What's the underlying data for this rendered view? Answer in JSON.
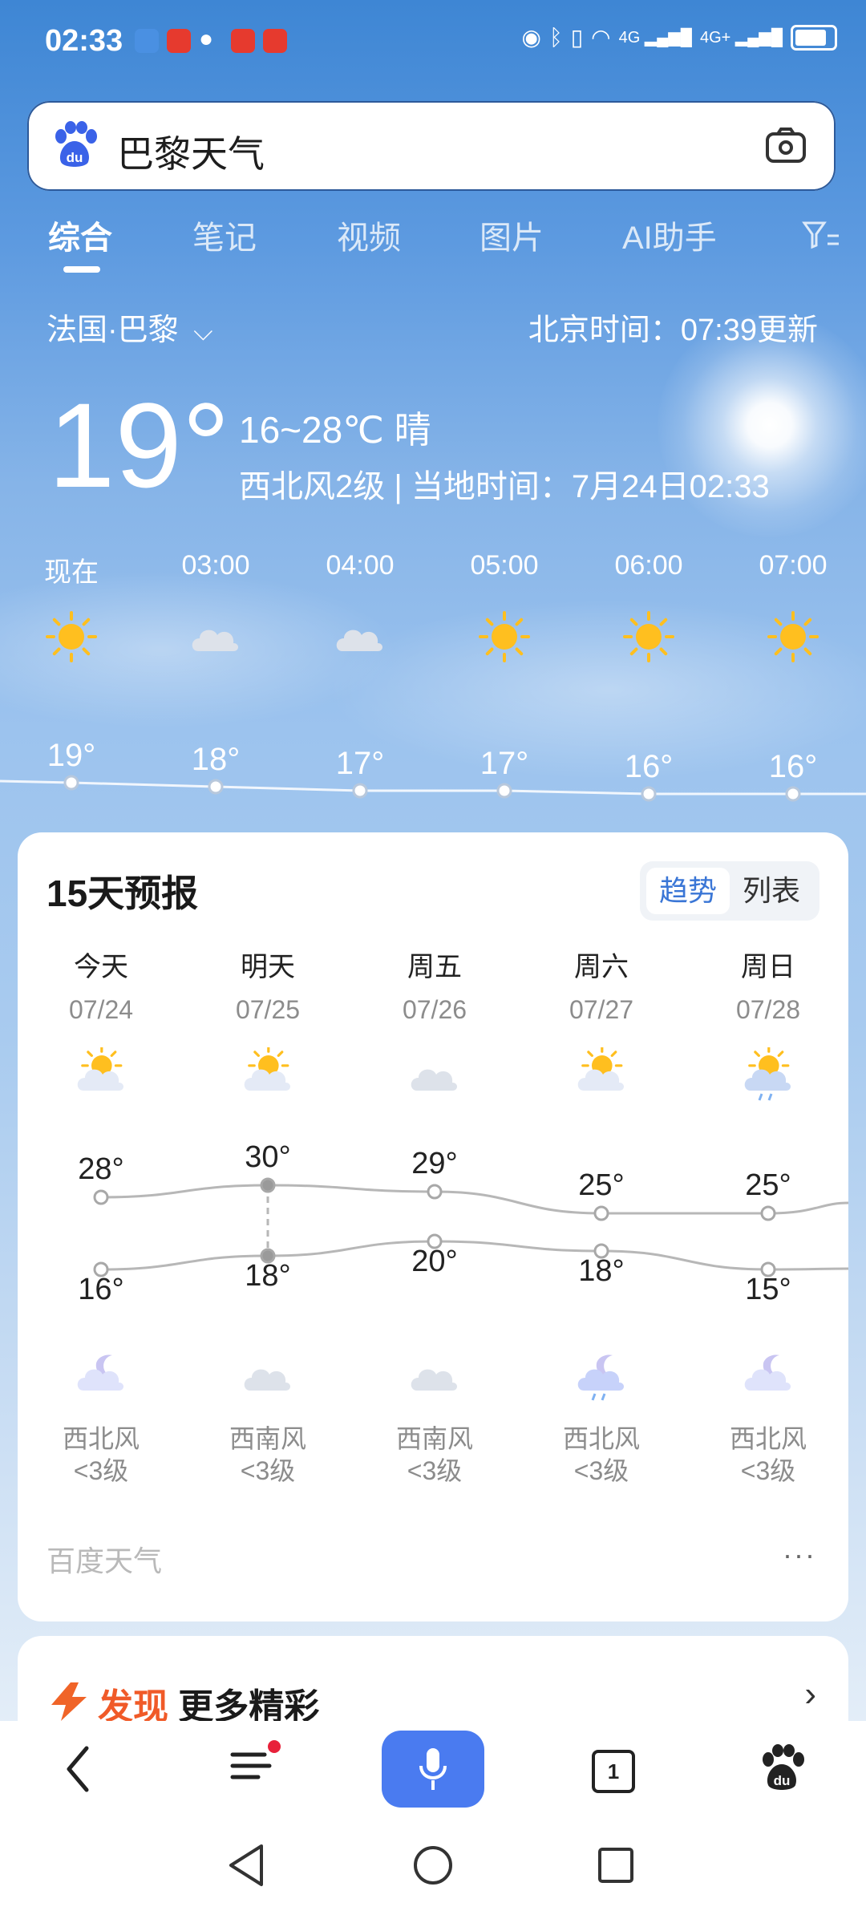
{
  "status": {
    "time": "02:33",
    "net1": "4G",
    "net2": "4G+"
  },
  "search": {
    "query": "巴黎天气"
  },
  "tabs": [
    "综合",
    "笔记",
    "视频",
    "图片",
    "AI助手"
  ],
  "weather": {
    "location": "法国·巴黎",
    "update": "北京时间：07:39更新",
    "current_temp": "19°",
    "range_condition": "16~28℃ 晴",
    "wind_local": "西北风2级 | 当地时间：7月24日02:33"
  },
  "hourly": [
    {
      "time": "现在",
      "icon": "sun-icon",
      "temp": "19°"
    },
    {
      "time": "03:00",
      "icon": "cloud-icon",
      "temp": "18°"
    },
    {
      "time": "04:00",
      "icon": "cloud-icon",
      "temp": "17°"
    },
    {
      "time": "05:00",
      "icon": "sun-icon",
      "temp": "17°"
    },
    {
      "time": "06:00",
      "icon": "sun-icon",
      "temp": "16°"
    },
    {
      "time": "07:00",
      "icon": "sun-icon",
      "temp": "16°"
    }
  ],
  "forecast": {
    "title": "15天预报",
    "toggle": [
      "趋势",
      "列表"
    ],
    "days": [
      {
        "name": "今天",
        "date": "07/24",
        "high": "28°",
        "low": "16°",
        "wind": "西北风",
        "level": "<3级",
        "day_icon": "partly-sunny-icon",
        "night_icon": "moon-cloud-icon"
      },
      {
        "name": "明天",
        "date": "07/25",
        "high": "30°",
        "low": "18°",
        "wind": "西南风",
        "level": "<3级",
        "day_icon": "partly-sunny-icon",
        "night_icon": "cloud-icon"
      },
      {
        "name": "周五",
        "date": "07/26",
        "high": "29°",
        "low": "20°",
        "wind": "西南风",
        "level": "<3级",
        "day_icon": "cloud-icon",
        "night_icon": "cloud-icon"
      },
      {
        "name": "周六",
        "date": "07/27",
        "high": "25°",
        "low": "18°",
        "wind": "西北风",
        "level": "<3级",
        "day_icon": "partly-sunny-icon",
        "night_icon": "moon-rain-icon"
      },
      {
        "name": "周日",
        "date": "07/28",
        "high": "25°",
        "low": "15°",
        "wind": "西北风",
        "level": "<3级",
        "day_icon": "sun-rain-icon",
        "night_icon": "moon-cloud-icon"
      }
    ],
    "source": "百度天气",
    "more": "···"
  },
  "discover": {
    "highlight": "发现",
    "rest": " 更多精彩"
  },
  "tab_count": "1",
  "colors": {
    "accent": "#4a7bf0",
    "discover": "#f05a28"
  }
}
